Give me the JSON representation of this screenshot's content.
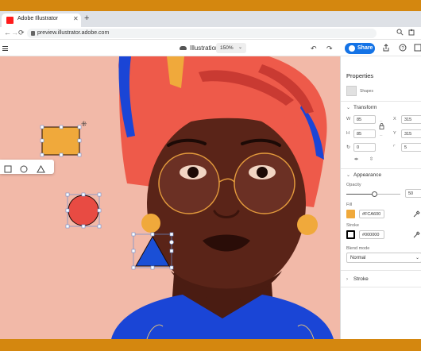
{
  "browser": {
    "tab_title": "Adobe Illustrator",
    "tab_close": "✕",
    "new_tab": "+",
    "back": "←",
    "forward": "→",
    "reload": "⟳",
    "url": "preview.illustrator.adobe.com"
  },
  "header": {
    "document_name": "Illustration",
    "zoom": "150%",
    "share_label": "Share"
  },
  "panel": {
    "title": "Properties",
    "selection_label": "Shapes",
    "sections": {
      "transform": "Transform",
      "appearance": "Appearance",
      "stroke": "Stroke"
    },
    "transform": {
      "w_label": "W",
      "w": "85",
      "x_label": "X",
      "x": "315",
      "h_label": "H",
      "h": "85",
      "y_label": "Y",
      "y": "315",
      "rotate": "0",
      "corner": "5"
    },
    "appearance": {
      "opacity_label": "Opacity",
      "opacity": "50",
      "opacity_fraction": 0.5,
      "fill_label": "Fill",
      "fill_hex": "#FCA600",
      "fill_color": "#f0a93b",
      "stroke_label": "Stroke",
      "stroke_hex": "#000000",
      "stroke_color": "#000000",
      "blend_label": "Blend mode",
      "blend_value": "Normal"
    }
  },
  "colors": {
    "canvas_bg": "#f2b9a8",
    "accent": "#1473e6",
    "square_fill": "#f0a93b",
    "circle_fill": "#e84b43",
    "triangle_fill": "#1a4fd6",
    "skin": "#5a2418",
    "headwrap": "#ee5a4a",
    "shirt": "#1a45d6",
    "glasses": "#e39a3c",
    "earring": "#f0a93b"
  }
}
